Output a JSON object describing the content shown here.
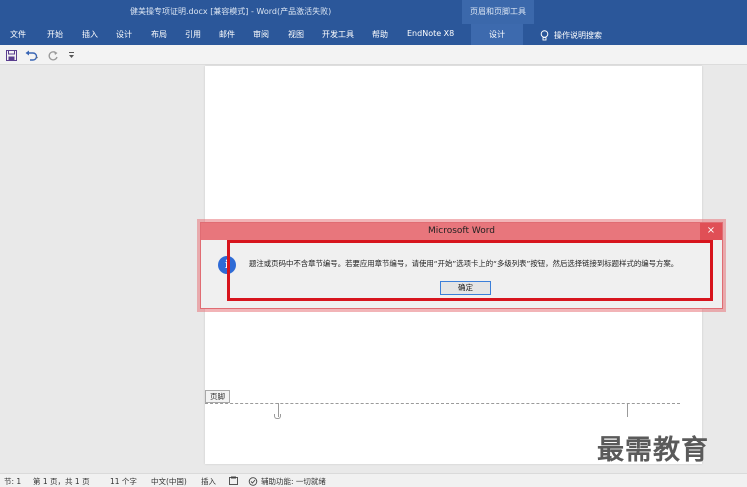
{
  "window": {
    "title": "健美操专项证明.docx [兼容模式] - Word(产品激活失败)",
    "contextual_group": "页眉和页脚工具"
  },
  "ribbon": {
    "tabs": [
      "文件",
      "开始",
      "插入",
      "设计",
      "布局",
      "引用",
      "邮件",
      "审阅",
      "视图",
      "开发工具",
      "帮助",
      "EndNote X8"
    ],
    "active_contextual_tab": "设计",
    "tell_me": "操作说明搜索"
  },
  "qat": {
    "save_icon": "save-icon",
    "undo_icon": "undo-icon",
    "redo_icon": "redo-icon",
    "customize_icon": "customize-qat-icon"
  },
  "document": {
    "footer_label": "页脚"
  },
  "dialog": {
    "title": "Microsoft Word",
    "close_glyph": "×",
    "message": "题注或页码中不含章节编号。若要应用章节编号，请使用“开始”选项卡上的“多级列表”按钮，然后选择链接到标题样式的编号方案。",
    "ok_label": "确定",
    "icon": "info-icon"
  },
  "statusbar": {
    "section": "节: 1",
    "page": "第 1 页，共 1 页",
    "words": "11 个字",
    "language": "中文(中国)",
    "mode": "插入",
    "accessibility": "辅助功能: 一切就绪"
  },
  "watermark": {
    "text": "最需教育"
  },
  "colors": {
    "ribbon": "#2b579a",
    "dialog_title": "#e8767c",
    "highlight": "#d7141d",
    "info": "#2f6bd6"
  }
}
